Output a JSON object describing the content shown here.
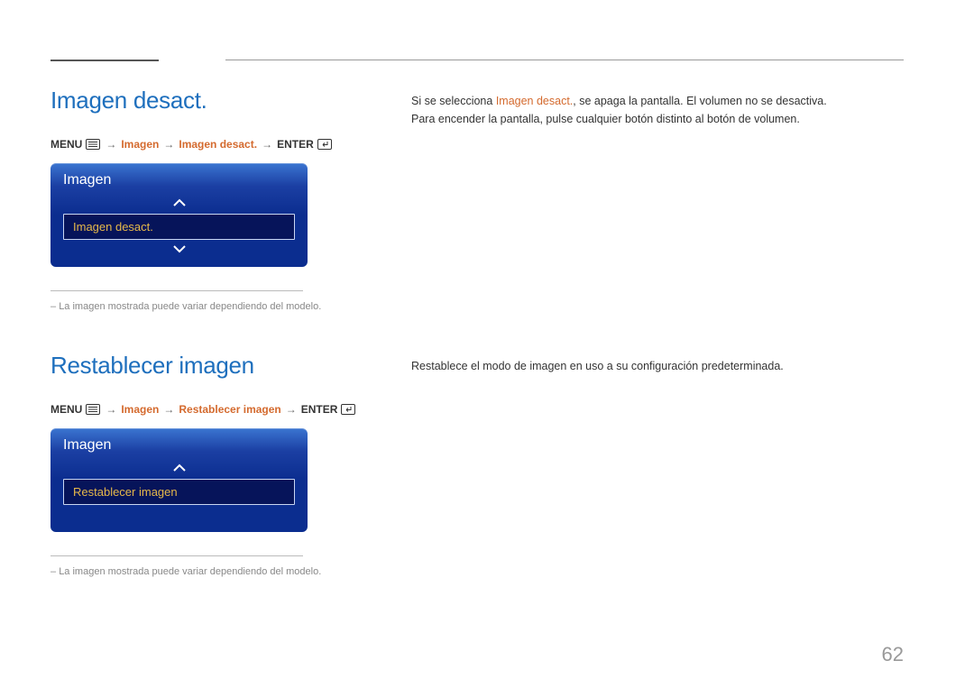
{
  "page_number": "62",
  "sections": [
    {
      "heading": "Imagen desact.",
      "breadcrumb": {
        "menu": "MENU",
        "level1": "Imagen",
        "level2": "Imagen desact.",
        "enter": "ENTER"
      },
      "osd": {
        "title": "Imagen",
        "selected_item": "Imagen desact.",
        "show_down_arrow": true
      },
      "note": "La imagen mostrada puede variar dependiendo del modelo.",
      "body_pre": "Si se selecciona ",
      "body_highlight": "Imagen desact.",
      "body_post": ", se apaga la pantalla. El volumen no se desactiva.",
      "body_line2": "Para encender la pantalla, pulse cualquier botón distinto al botón de volumen."
    },
    {
      "heading": "Restablecer imagen",
      "breadcrumb": {
        "menu": "MENU",
        "level1": "Imagen",
        "level2": "Restablecer imagen",
        "enter": "ENTER"
      },
      "osd": {
        "title": "Imagen",
        "selected_item": "Restablecer imagen",
        "show_down_arrow": false
      },
      "note": "La imagen mostrada puede variar dependiendo del modelo.",
      "body_line1": "Restablece el modo de imagen en uso a su configuración predeterminada."
    }
  ]
}
